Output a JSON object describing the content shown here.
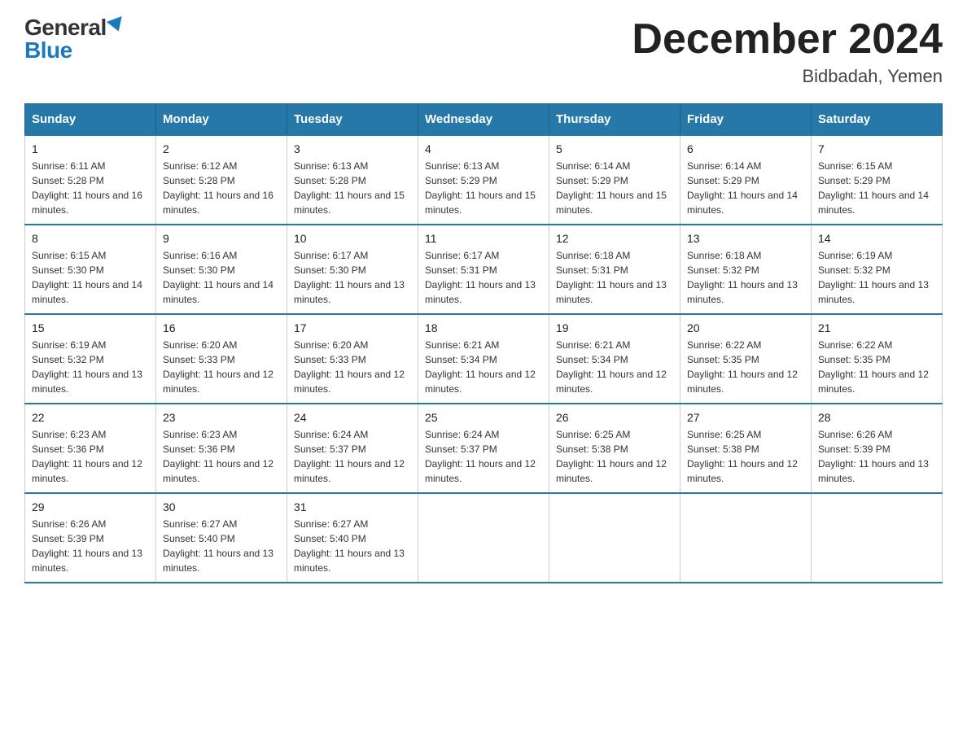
{
  "logo": {
    "general": "General",
    "blue": "Blue"
  },
  "title": "December 2024",
  "subtitle": "Bidbadah, Yemen",
  "headers": [
    "Sunday",
    "Monday",
    "Tuesday",
    "Wednesday",
    "Thursday",
    "Friday",
    "Saturday"
  ],
  "weeks": [
    [
      {
        "day": "1",
        "sunrise": "6:11 AM",
        "sunset": "5:28 PM",
        "daylight": "11 hours and 16 minutes."
      },
      {
        "day": "2",
        "sunrise": "6:12 AM",
        "sunset": "5:28 PM",
        "daylight": "11 hours and 16 minutes."
      },
      {
        "day": "3",
        "sunrise": "6:13 AM",
        "sunset": "5:28 PM",
        "daylight": "11 hours and 15 minutes."
      },
      {
        "day": "4",
        "sunrise": "6:13 AM",
        "sunset": "5:29 PM",
        "daylight": "11 hours and 15 minutes."
      },
      {
        "day": "5",
        "sunrise": "6:14 AM",
        "sunset": "5:29 PM",
        "daylight": "11 hours and 15 minutes."
      },
      {
        "day": "6",
        "sunrise": "6:14 AM",
        "sunset": "5:29 PM",
        "daylight": "11 hours and 14 minutes."
      },
      {
        "day": "7",
        "sunrise": "6:15 AM",
        "sunset": "5:29 PM",
        "daylight": "11 hours and 14 minutes."
      }
    ],
    [
      {
        "day": "8",
        "sunrise": "6:15 AM",
        "sunset": "5:30 PM",
        "daylight": "11 hours and 14 minutes."
      },
      {
        "day": "9",
        "sunrise": "6:16 AM",
        "sunset": "5:30 PM",
        "daylight": "11 hours and 14 minutes."
      },
      {
        "day": "10",
        "sunrise": "6:17 AM",
        "sunset": "5:30 PM",
        "daylight": "11 hours and 13 minutes."
      },
      {
        "day": "11",
        "sunrise": "6:17 AM",
        "sunset": "5:31 PM",
        "daylight": "11 hours and 13 minutes."
      },
      {
        "day": "12",
        "sunrise": "6:18 AM",
        "sunset": "5:31 PM",
        "daylight": "11 hours and 13 minutes."
      },
      {
        "day": "13",
        "sunrise": "6:18 AM",
        "sunset": "5:32 PM",
        "daylight": "11 hours and 13 minutes."
      },
      {
        "day": "14",
        "sunrise": "6:19 AM",
        "sunset": "5:32 PM",
        "daylight": "11 hours and 13 minutes."
      }
    ],
    [
      {
        "day": "15",
        "sunrise": "6:19 AM",
        "sunset": "5:32 PM",
        "daylight": "11 hours and 13 minutes."
      },
      {
        "day": "16",
        "sunrise": "6:20 AM",
        "sunset": "5:33 PM",
        "daylight": "11 hours and 12 minutes."
      },
      {
        "day": "17",
        "sunrise": "6:20 AM",
        "sunset": "5:33 PM",
        "daylight": "11 hours and 12 minutes."
      },
      {
        "day": "18",
        "sunrise": "6:21 AM",
        "sunset": "5:34 PM",
        "daylight": "11 hours and 12 minutes."
      },
      {
        "day": "19",
        "sunrise": "6:21 AM",
        "sunset": "5:34 PM",
        "daylight": "11 hours and 12 minutes."
      },
      {
        "day": "20",
        "sunrise": "6:22 AM",
        "sunset": "5:35 PM",
        "daylight": "11 hours and 12 minutes."
      },
      {
        "day": "21",
        "sunrise": "6:22 AM",
        "sunset": "5:35 PM",
        "daylight": "11 hours and 12 minutes."
      }
    ],
    [
      {
        "day": "22",
        "sunrise": "6:23 AM",
        "sunset": "5:36 PM",
        "daylight": "11 hours and 12 minutes."
      },
      {
        "day": "23",
        "sunrise": "6:23 AM",
        "sunset": "5:36 PM",
        "daylight": "11 hours and 12 minutes."
      },
      {
        "day": "24",
        "sunrise": "6:24 AM",
        "sunset": "5:37 PM",
        "daylight": "11 hours and 12 minutes."
      },
      {
        "day": "25",
        "sunrise": "6:24 AM",
        "sunset": "5:37 PM",
        "daylight": "11 hours and 12 minutes."
      },
      {
        "day": "26",
        "sunrise": "6:25 AM",
        "sunset": "5:38 PM",
        "daylight": "11 hours and 12 minutes."
      },
      {
        "day": "27",
        "sunrise": "6:25 AM",
        "sunset": "5:38 PM",
        "daylight": "11 hours and 12 minutes."
      },
      {
        "day": "28",
        "sunrise": "6:26 AM",
        "sunset": "5:39 PM",
        "daylight": "11 hours and 13 minutes."
      }
    ],
    [
      {
        "day": "29",
        "sunrise": "6:26 AM",
        "sunset": "5:39 PM",
        "daylight": "11 hours and 13 minutes."
      },
      {
        "day": "30",
        "sunrise": "6:27 AM",
        "sunset": "5:40 PM",
        "daylight": "11 hours and 13 minutes."
      },
      {
        "day": "31",
        "sunrise": "6:27 AM",
        "sunset": "5:40 PM",
        "daylight": "11 hours and 13 minutes."
      },
      null,
      null,
      null,
      null
    ]
  ]
}
